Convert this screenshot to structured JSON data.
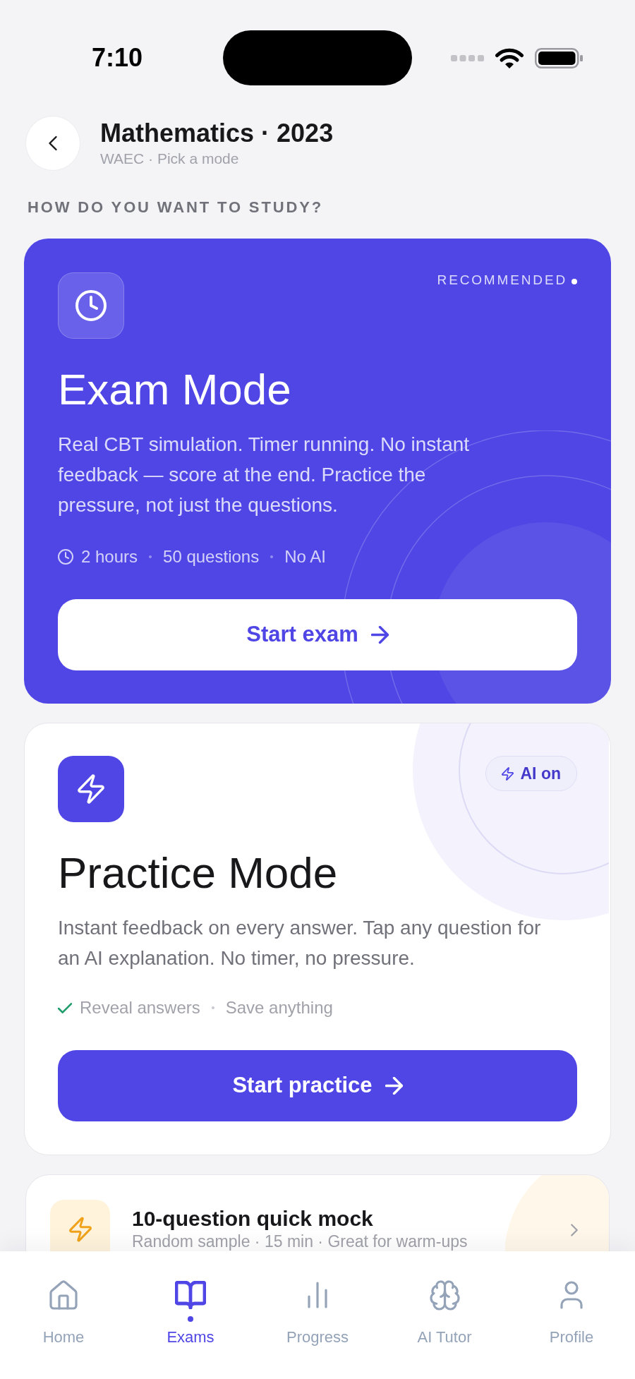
{
  "status_bar": {
    "time": "7:10"
  },
  "header": {
    "title": "Mathematics · 2023",
    "subtitle": "WAEC · Pick a mode"
  },
  "section_label": "HOW DO YOU WANT TO STUDY?",
  "modes": [
    {
      "kind": "exam",
      "badge": "RECOMMENDED",
      "title": "Exam Mode",
      "description": "Real CBT simulation. Timer running. No instant feedback — score at the end. Practice the pressure, not just the questions.",
      "meta": [
        {
          "kind": "duration",
          "text": "2 hours"
        },
        {
          "kind": "plain",
          "text": "50 questions"
        },
        {
          "kind": "plain",
          "text": "No AI"
        }
      ],
      "button": "Start exam"
    },
    {
      "kind": "practice",
      "badge": "AI on",
      "title": "Practice Mode",
      "description": "Instant feedback on every answer. Tap any question for an AI explanation. No timer, no pressure.",
      "meta": [
        {
          "kind": "included",
          "text": "Reveal answers"
        },
        {
          "kind": "plain",
          "text": "Save anything"
        }
      ],
      "button": "Start practice"
    }
  ],
  "quick_mock": {
    "title": "10-question quick mock",
    "subtitle": "Random sample · 15 min · Great for warm-ups"
  },
  "tab_bar": [
    {
      "label": "Home",
      "selected": false
    },
    {
      "label": "Exams",
      "selected": true
    },
    {
      "label": "Progress",
      "selected": false
    },
    {
      "label": "AI Tutor",
      "selected": false
    },
    {
      "label": "Profile",
      "selected": false
    }
  ]
}
